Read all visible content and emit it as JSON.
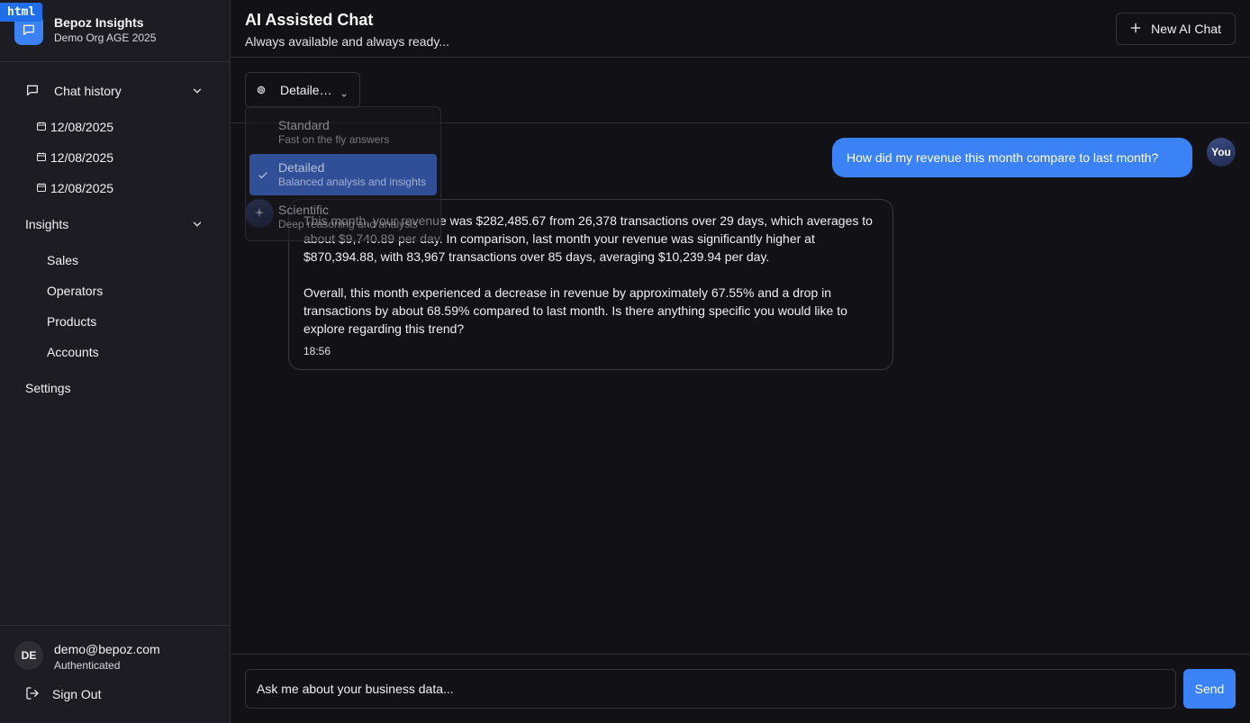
{
  "badge": {
    "label": "html"
  },
  "brand": {
    "name": "Bepoz Insights",
    "org": "Demo Org AGE 2025"
  },
  "sidebar": {
    "chat_history": {
      "label": "Chat history",
      "dates": [
        "12/08/2025",
        "12/08/2025",
        "12/08/2025"
      ]
    },
    "insights": {
      "label": "Insights",
      "items": [
        "Sales",
        "Operators",
        "Products",
        "Accounts"
      ]
    },
    "settings_label": "Settings"
  },
  "user": {
    "initials": "DE",
    "email": "demo@bepoz.com",
    "status": "Authenticated",
    "sign_out": "Sign Out"
  },
  "header": {
    "title": "AI Assisted Chat",
    "subtitle": "Always available and always ready...",
    "new_chat": "New AI Chat"
  },
  "mode": {
    "selected_label": "Detaile…",
    "options": [
      {
        "title": "Standard",
        "desc": "Fast on the fly answers"
      },
      {
        "title": "Detailed",
        "desc": "Balanced analysis and insights"
      },
      {
        "title": "Scientific",
        "desc": "Deep reasoning and analysis"
      }
    ]
  },
  "chat": {
    "user_label": "You",
    "user_message": "How did my revenue this month compare to last month?",
    "ai_paragraphs": [
      "This month, your revenue was $282,485.67 from 26,378 transactions over 29 days, which averages to about $9,740.89 per day. In comparison, last month your revenue was significantly higher at $870,394.88, with 83,967 transactions over 85 days, averaging $10,239.94 per day.",
      "Overall, this month experienced a decrease in revenue by approximately 67.55% and a drop in transactions by about 68.59% compared to last month. Is there anything specific you would like to explore regarding this trend?"
    ],
    "ai_time": "18:56"
  },
  "composer": {
    "placeholder": "Ask me about your business data...",
    "send": "Send"
  },
  "colors": {
    "accent": "#3b82f6",
    "background": "#121116",
    "sidebar": "#1d1c22",
    "border": "#2f2e35"
  }
}
